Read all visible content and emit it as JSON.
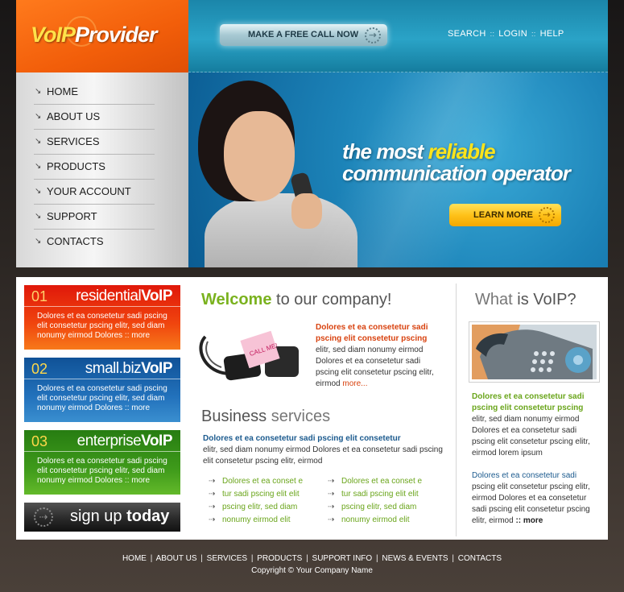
{
  "header": {
    "logo": {
      "part1": "VoIP",
      "part2": "Provider"
    },
    "free_call_button": "MAKE A FREE CALL NOW",
    "top_links": [
      "SEARCH",
      "LOGIN",
      "HELP"
    ],
    "top_links_sep": "::"
  },
  "nav": {
    "items": [
      "HOME",
      "ABOUT US",
      "SERVICES",
      "PRODUCTS",
      "YOUR ACCOUNT",
      "SUPPORT",
      "CONTACTS"
    ],
    "bullet": "↘"
  },
  "hero": {
    "line1_prefix": "the most ",
    "line1_highlight": "reliable",
    "line2": "communication operator",
    "learn_more": "LEARN MORE"
  },
  "promos": [
    {
      "num": "01",
      "title_light": "residential",
      "title_bold": "VoIP",
      "text": "Dolores et ea consetetur sadi pscing elit consetetur pscing elitr, sed diam nonumy eirmod Dolores :: more"
    },
    {
      "num": "02",
      "title_light": "small.biz",
      "title_bold": "VoIP",
      "text": "Dolores et ea consetetur sadi pscing elit consetetur pscing elitr, sed diam nonumy eirmod Dolores :: more"
    },
    {
      "num": "03",
      "title_light": "enterprise",
      "title_bold": "VoIP",
      "text": "Dolores et ea consetetur sadi pscing elit consetetur pscing elitr, sed diam nonumy eirmod Dolores :: more"
    }
  ],
  "signup": {
    "light": "sign up ",
    "bold": "today"
  },
  "welcome": {
    "title_bold": "Welcome",
    "title_rest": " to our company!",
    "sticky_note": "CALL ME!",
    "head": "Dolores et ea consetetur sadi pscing elit consetetur pscing",
    "body": "elitr, sed diam nonumy eirmod Dolores et ea consetetur sadi pscing elit consetetur pscing elitr, eirmod ",
    "more": "more..."
  },
  "business": {
    "title_dark": "Business",
    "title_light": " services",
    "head": "Dolores et ea consetetur sadi pscing elit consetetur",
    "body": "elitr, sed diam nonumy eirmod Dolores et ea consetetur sadi pscing elit consetetur pscing elitr, eirmod",
    "list_bullet": "⇢",
    "list_left": [
      "Dolores et ea conset e",
      "tur sadi pscing elit elit",
      "pscing elitr, sed diam",
      "nonumy eirmod  elit"
    ],
    "list_right": [
      "Dolores et ea conset e",
      "tur sadi pscing elit elit",
      "pscing elitr, sed diam",
      "nonumy eirmod  elit"
    ]
  },
  "voip": {
    "title_dark": "What",
    "title_light": " is VoIP?",
    "head": "Dolores et ea consetetur sadi pscing elit consetetur pscing",
    "body1": "elitr, sed diam nonumy eirmod Dolores et ea consetetur sadi pscing elit consetetur pscing elitr, eirmod lorem ipsum",
    "head2": "Dolores et ea consetetur sadi",
    "body2": "pscing elit consetetur pscing elitr, eirmod Dolores et ea consetetur sadi pscing elit consetetur pscing elitr, eirmod ",
    "more": ":: more"
  },
  "footer": {
    "links": [
      "HOME",
      "ABOUT US",
      "SERVICES",
      "PRODUCTS",
      "SUPPORT INFO",
      "NEWS & EVENTS",
      "CONTACTS"
    ],
    "separator": "|",
    "copyright": "Copyright © Your Company Name"
  },
  "colors": {
    "brand_orange": "#f25e0a",
    "header_teal": "#2aa3c7",
    "accent_green": "#7ab21e",
    "accent_red": "#d8420f",
    "accent_blue": "#1b5a8e"
  }
}
